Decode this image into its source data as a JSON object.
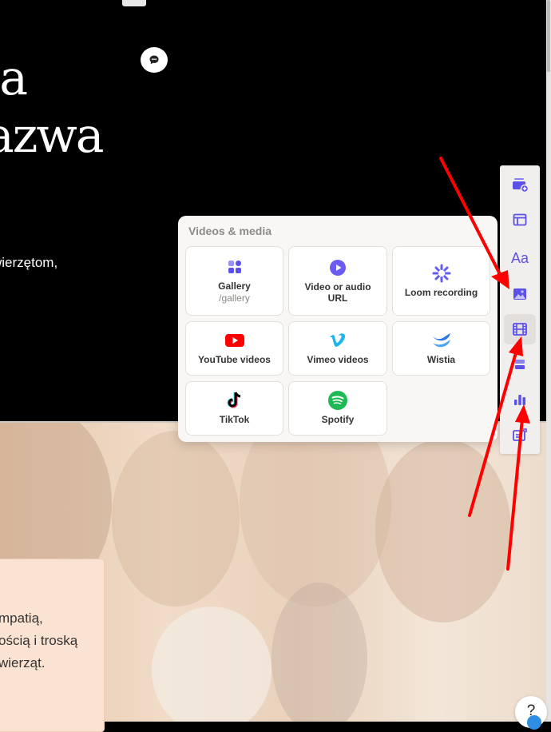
{
  "hero": {
    "title_line1": "la",
    "title_line2": "azwa",
    "subtitle": "wierzętom,"
  },
  "quote": {
    "line1": "mpatią,",
    "line2": "ością i troską",
    "line3": "wierząt."
  },
  "popover": {
    "title": "Videos & media",
    "items": [
      {
        "label": "Gallery",
        "slug": "/gallery",
        "icon": "gallery-icon",
        "color": "#5b50e8"
      },
      {
        "label": "Video or audio URL",
        "icon": "play-icon",
        "color": "#6a5cf0"
      },
      {
        "label": "Loom recording",
        "icon": "loom-icon",
        "color": "#625df5"
      },
      {
        "label": "YouTube videos",
        "icon": "youtube-icon",
        "color": "#ff0000"
      },
      {
        "label": "Vimeo videos",
        "icon": "vimeo-icon",
        "color": "#1ab7ea"
      },
      {
        "label": "Wistia",
        "icon": "wistia-icon",
        "color": "#2a78e8"
      },
      {
        "label": "TikTok",
        "icon": "tiktok-icon",
        "color": "#000000"
      },
      {
        "label": "Spotify",
        "icon": "spotify-icon",
        "color": "#1db954"
      }
    ]
  },
  "toolbar": {
    "items": [
      {
        "icon": "add-block-icon"
      },
      {
        "icon": "layout-icon"
      },
      {
        "icon": "text-icon",
        "glyph": "Aa"
      },
      {
        "icon": "image-icon"
      },
      {
        "icon": "video-icon",
        "active": true
      },
      {
        "icon": "list-icon"
      },
      {
        "icon": "chart-icon"
      },
      {
        "icon": "embed-icon"
      }
    ],
    "accent": "#5b50e8"
  },
  "help": {
    "label": "?"
  },
  "annotation_color": "#ff0000"
}
